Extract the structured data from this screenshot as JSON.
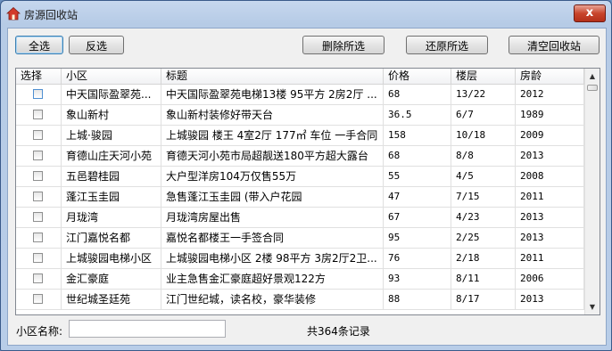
{
  "window": {
    "title": "房源回收站",
    "close_label": "x"
  },
  "toolbar": {
    "select_all": "全选",
    "invert": "反选",
    "delete_selected": "删除所选",
    "restore_selected": "还原所选",
    "empty_bin": "清空回收站"
  },
  "table": {
    "columns": [
      "选择",
      "小区",
      "标题",
      "价格",
      "楼层",
      "房龄"
    ],
    "rows": [
      {
        "community": "中天国际盈翠苑...",
        "title": "中天国际盈翠苑电梯13楼 95平方 2房2厅 ...",
        "price": "68",
        "floor": "13/22",
        "age": "2012"
      },
      {
        "community": "象山新村",
        "title": "象山新村装修好带天台",
        "price": "36.5",
        "floor": "6/7",
        "age": "1989"
      },
      {
        "community": "上城·骏园",
        "title": "上城骏园 楼王 4室2厅 177㎡ 车位 一手合同",
        "price": "158",
        "floor": "10/18",
        "age": "2009"
      },
      {
        "community": "育德山庄天河小苑",
        "title": "育德天河小苑市局超靓送180平方超大露台",
        "price": "68",
        "floor": "8/8",
        "age": "2013"
      },
      {
        "community": "五邑碧桂园",
        "title": "大户型洋房104万仅售55万",
        "price": "55",
        "floor": "4/5",
        "age": "2008"
      },
      {
        "community": "蓬江玉圭园",
        "title": "急售蓬江玉圭园 (带入户花园",
        "price": "47",
        "floor": "7/15",
        "age": "2011"
      },
      {
        "community": "月珑湾",
        "title": "月珑湾房屋出售",
        "price": "67",
        "floor": "4/23",
        "age": "2013"
      },
      {
        "community": "江门嘉悦名都",
        "title": "嘉悦名都楼王一手签合同",
        "price": "95",
        "floor": "2/25",
        "age": "2013"
      },
      {
        "community": "上城骏园电梯小区",
        "title": "上城骏园电梯小区 2楼 98平方 3房2厅2卫...",
        "price": "76",
        "floor": "2/18",
        "age": "2011"
      },
      {
        "community": "金汇豪庭",
        "title": "业主急售金汇豪庭超好景观122方",
        "price": "93",
        "floor": "8/11",
        "age": "2006"
      },
      {
        "community": "世纪城圣廷苑",
        "title": "江门世纪城，读名校，豪华装修",
        "price": "88",
        "floor": "8/17",
        "age": "2013"
      }
    ]
  },
  "footer": {
    "search_label": "小区名称:",
    "search_value": "",
    "record_count": "共364条记录"
  },
  "colors": {
    "title_bg": "#b9cde8",
    "close_red": "#c8452c",
    "grid_border": "#828790"
  }
}
